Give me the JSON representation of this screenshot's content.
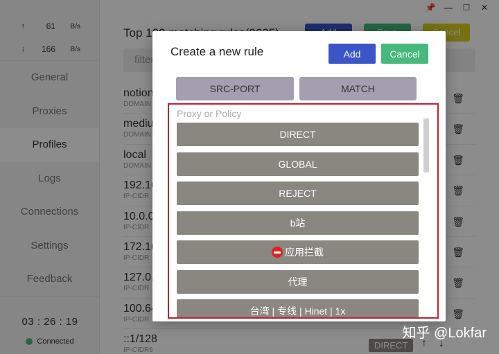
{
  "traffic": {
    "up_arrow": "↑",
    "up_value": "61",
    "up_unit": "B/s",
    "down_arrow": "↓",
    "down_value": "166",
    "down_unit": "B/s"
  },
  "nav": {
    "items": [
      {
        "label": "General"
      },
      {
        "label": "Proxies"
      },
      {
        "label": "Profiles"
      },
      {
        "label": "Logs"
      },
      {
        "label": "Connections"
      },
      {
        "label": "Settings"
      },
      {
        "label": "Feedback"
      }
    ],
    "active_index": 2
  },
  "status": {
    "time": "03 : 26 : 19",
    "connection": "Connected",
    "connection_color": "#47b97d"
  },
  "titlebar": {
    "pin": "📌",
    "minimize": "—",
    "maximize": "☐",
    "close": "✕"
  },
  "main": {
    "title": "Top 100 matching rules(9635)",
    "add_label": "Add",
    "save_label": "Save",
    "cancel_label": "Cancel",
    "filter_placeholder": "filter",
    "rules": [
      {
        "payload": "notion",
        "type": "DOMAIN"
      },
      {
        "payload": "medium",
        "type": "DOMAIN"
      },
      {
        "payload": "local",
        "type": "DOMAIN"
      },
      {
        "payload": "192.16",
        "type": "IP-CIDR"
      },
      {
        "payload": "10.0.0",
        "type": "IP-CIDR"
      },
      {
        "payload": "172.16",
        "type": "IP-CIDR"
      },
      {
        "payload": "127.0.",
        "type": "IP-CIDR"
      },
      {
        "payload": "100.64",
        "type": "IP-CIDR"
      },
      {
        "payload": "::1/128",
        "type": "IP-CIDR6",
        "policy": "DIRECT"
      }
    ],
    "delete_icon": "🗑",
    "up_icon": "↑",
    "down_icon": "↓"
  },
  "modal": {
    "title": "Create a new rule",
    "add_label": "Add",
    "cancel_label": "Cancel",
    "add_color": "#3b55c9",
    "cancel_color": "#47b97d",
    "rule_types": [
      "SRC-PORT",
      "MATCH"
    ],
    "policy_label": "Proxy or Policy",
    "policies": [
      "DIRECT",
      "GLOBAL",
      "REJECT",
      "b站",
      "应用拦截",
      "代理",
      "台湾 | 专线 | Hinet | 1x"
    ],
    "highlight_color": "#c4202a"
  },
  "watermark": "知乎 @Lokfar"
}
